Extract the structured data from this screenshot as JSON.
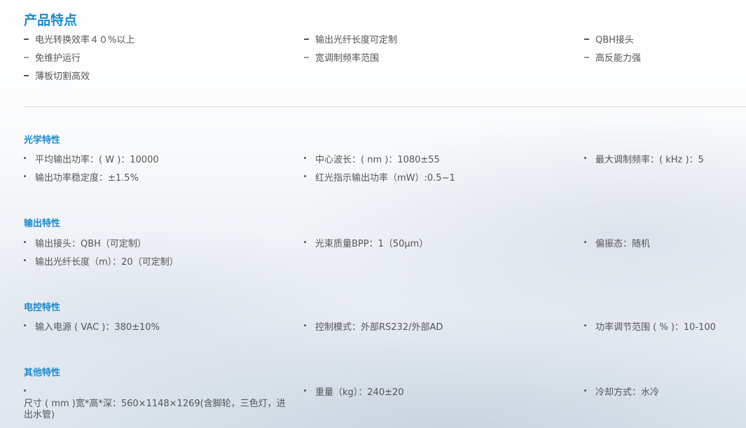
{
  "product_features": {
    "title": "产品特点",
    "rows": [
      [
        "电光转换效率４０%以上",
        "输出光纤长度可定制",
        "QBH接头"
      ],
      [
        "免维护运行",
        "宽调制频率范围",
        "高反能力强"
      ],
      [
        "薄板切割高效",
        "",
        ""
      ]
    ]
  },
  "sections": [
    {
      "title": "光学特性",
      "rows": [
        [
          "平均输出功率：( W )：10000",
          "中心波长：( nm )：1080±55",
          "最大调制频率：( kHz )：5"
        ],
        [
          "输出功率稳定度：±1.5%",
          "红光指示输出功率（mW）:0.5~1",
          ""
        ]
      ]
    },
    {
      "title": "输出特性",
      "rows": [
        [
          "输出接头：QBH（可定制）",
          "光束质量BPP：1（50μm）",
          "偏振态：随机"
        ],
        [
          "输出光纤长度（m）：20（可定制）",
          "",
          ""
        ]
      ]
    },
    {
      "title": "电控特性",
      "rows": [
        [
          "输入电源 ( VAC )：380±10%",
          "控制模式：外部RS232/外部AD",
          "功率调节范围 ( % )：10-100"
        ]
      ]
    },
    {
      "title": "其他特性",
      "rows": [
        [
          "尺寸 ( mm )宽*高*深：560×1148×1269(含脚轮，三色灯，进出水管)",
          "重量（kg）：240±20",
          "冷却方式：水冷"
        ]
      ]
    }
  ]
}
